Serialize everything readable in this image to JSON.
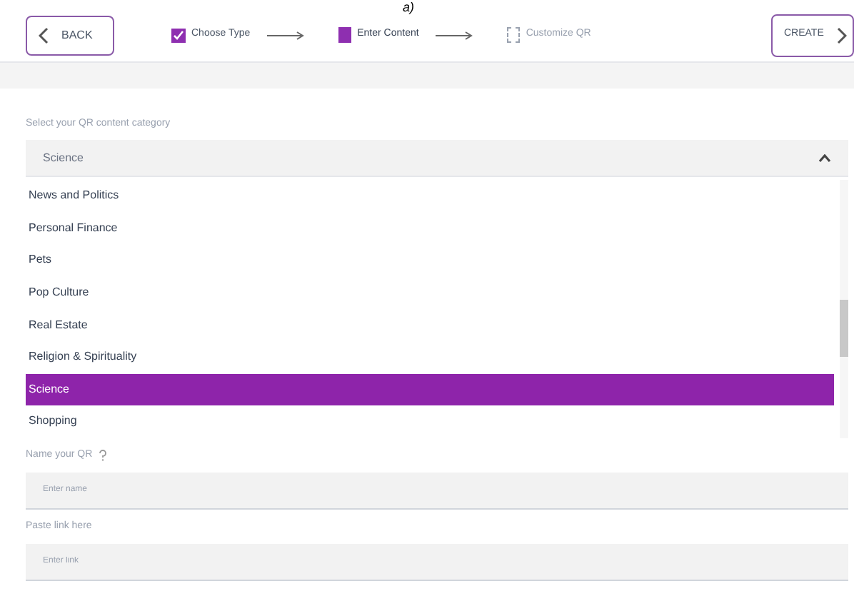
{
  "caption": "a)",
  "header": {
    "back": "BACK",
    "create": "CREATE",
    "steps": [
      {
        "label": "Choose Type",
        "completed": true,
        "selected": false,
        "arrow": true
      },
      {
        "label": "Enter Content",
        "completed": false,
        "selected": true,
        "arrow": true
      },
      {
        "label": "Customize QR",
        "completed": false,
        "selected": false,
        "arrow": false
      }
    ]
  },
  "category": {
    "label": "Select your QR content category",
    "value": "Science",
    "expanded": true,
    "options": [
      {
        "label": "News and Politics",
        "selected": false
      },
      {
        "label": "Personal Finance",
        "selected": false
      },
      {
        "label": "Pets",
        "selected": false
      },
      {
        "label": "Pop Culture",
        "selected": false
      },
      {
        "label": "Real Estate",
        "selected": false
      },
      {
        "label": "Religion & Spirituality",
        "selected": false
      },
      {
        "label": "Science",
        "selected": true
      },
      {
        "label": "Shopping",
        "selected": false
      }
    ]
  },
  "name_field": {
    "label": "Name your QR",
    "placeholder": "Enter name"
  },
  "link_field": {
    "label": "Paste link here",
    "placeholder": "Enter link"
  }
}
